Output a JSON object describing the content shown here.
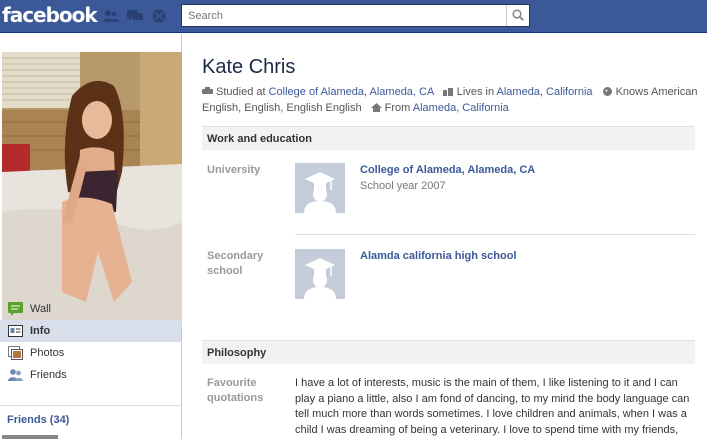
{
  "topbar": {
    "logo": "facebook",
    "search_placeholder": "Search"
  },
  "profile": {
    "name": "Kate Chris",
    "summary": {
      "studied_prefix": "Studied at",
      "studied_link": "College of Alameda, Alameda, CA",
      "lives_prefix": "Lives in",
      "lives_link": "Alameda, California",
      "knows": "Knows American English, English, English English",
      "from_prefix": "From",
      "from_link": "Alameda, California"
    }
  },
  "sidebar": {
    "items": [
      {
        "label": "Wall",
        "icon": "wall-icon"
      },
      {
        "label": "Info",
        "icon": "info-icon",
        "active": true
      },
      {
        "label": "Photos",
        "icon": "photos-icon"
      },
      {
        "label": "Friends",
        "icon": "friends-icon"
      }
    ],
    "friends_header": "Friends (34)"
  },
  "work_education": {
    "heading": "Work and education",
    "entries": [
      {
        "label": "University",
        "school": "College of Alameda, Alameda, CA",
        "detail": "School year 2007"
      },
      {
        "label": "Secondary school",
        "school": "Alamda california high school",
        "detail": ""
      }
    ]
  },
  "philosophy": {
    "heading": "Philosophy",
    "label": "Favourite quotations",
    "text": "I have a lot of interests, music is the main of them, I like listening to it and I can play a piano a little, also I am fond of dancing, to my mind the body language can tell much more than words sometimes. I love children and animals, when I was a child I was dreaming of being a veterinary. I love to spend time with my friends,"
  },
  "colors": {
    "brand": "#3b5998",
    "link": "#3b5998",
    "active_nav": "#d8dfea"
  }
}
